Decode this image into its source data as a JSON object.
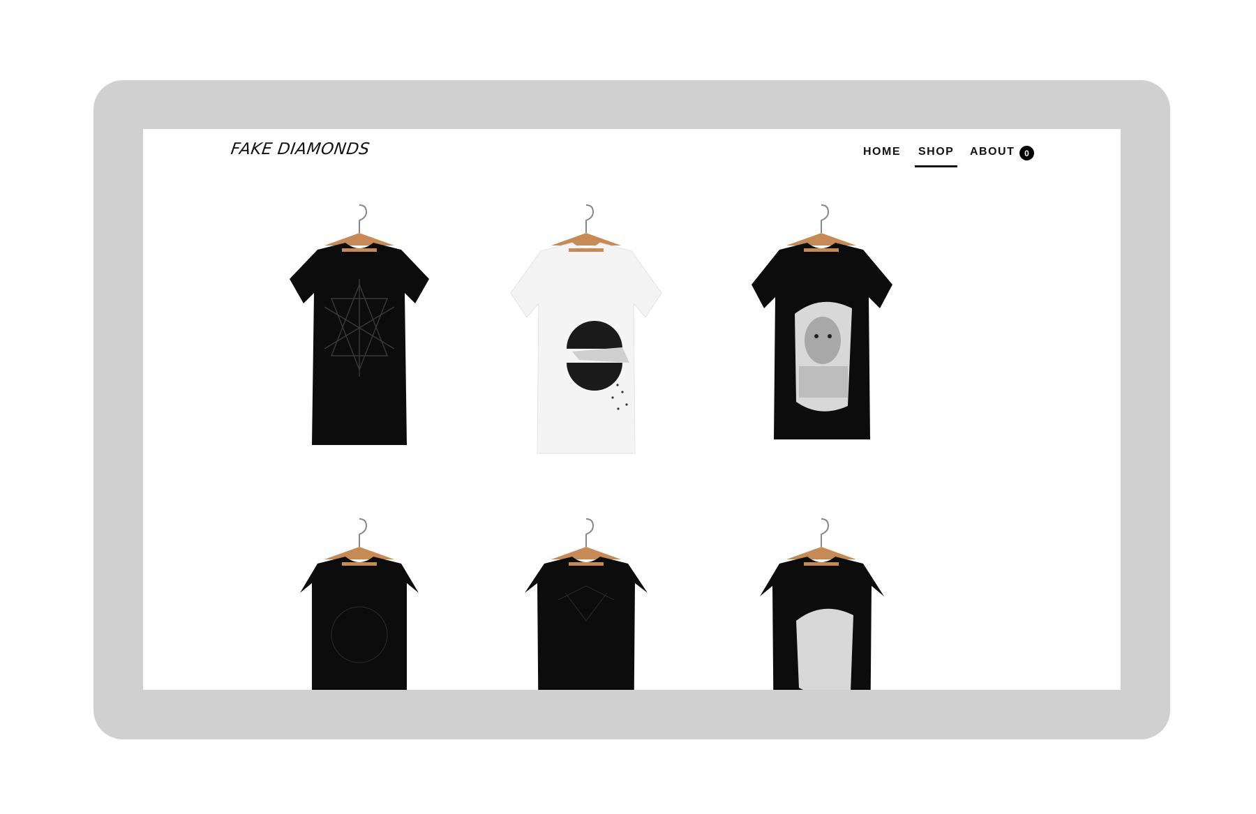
{
  "site": {
    "logo": "FAKE DIAMONDS"
  },
  "nav": {
    "items": [
      {
        "label": "HOME",
        "active": false
      },
      {
        "label": "SHOP",
        "active": true
      },
      {
        "label": "ABOUT",
        "active": false
      }
    ],
    "cart_count": "0"
  },
  "products": [
    {
      "shirt": "black",
      "graphic": "geometric-lines"
    },
    {
      "shirt": "white",
      "graphic": "hand-collage"
    },
    {
      "shirt": "black",
      "graphic": "portrait-collage"
    },
    {
      "shirt": "black",
      "graphic": "circle-lines"
    },
    {
      "shirt": "black",
      "graphic": "starburst"
    },
    {
      "shirt": "black",
      "graphic": "portrait-collage"
    }
  ],
  "colors": {
    "device_frame": "#d0d0d0",
    "text": "#111111",
    "shirt_black": "#0c0c0c",
    "shirt_white": "#f4f4f4",
    "hanger_wood": "#c58a55"
  }
}
